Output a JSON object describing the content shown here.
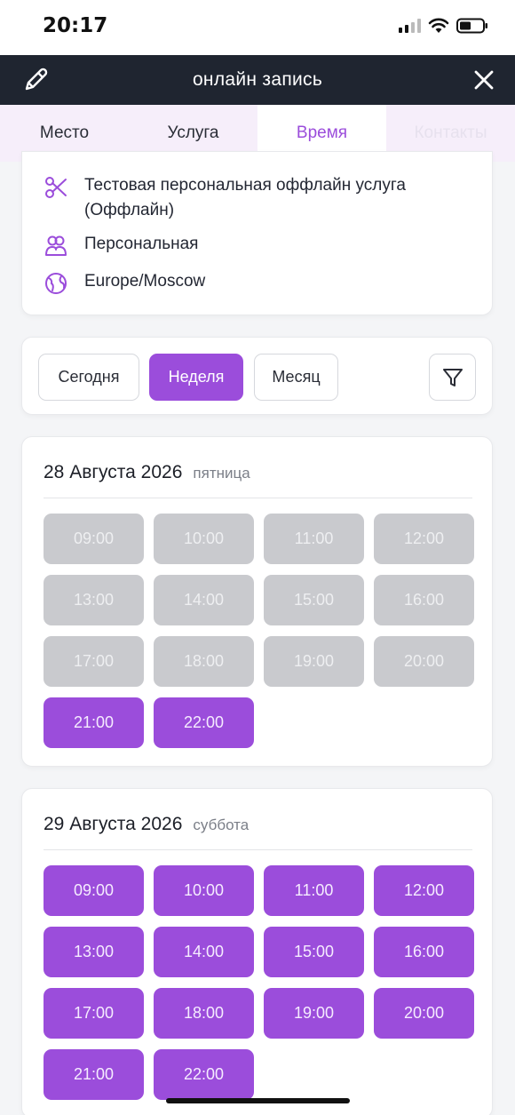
{
  "status": {
    "time": "20:17"
  },
  "header": {
    "title": "онлайн запись",
    "left_icon": "pencil-icon",
    "right_icon": "close-icon"
  },
  "tabs": [
    {
      "label": "Место",
      "state": "normal"
    },
    {
      "label": "Услуга",
      "state": "normal"
    },
    {
      "label": "Время",
      "state": "active"
    },
    {
      "label": "Контакты",
      "state": "disabled"
    }
  ],
  "info": {
    "service": "Тестовая персональная оффлайн услуга (Оффлайн)",
    "type": "Персональная",
    "timezone": "Europe/Moscow"
  },
  "filters": {
    "today": "Сегодня",
    "week": "Неделя",
    "month": "Месяц",
    "active": "week"
  },
  "days": [
    {
      "date": "28 Августа 2026",
      "weekday": "пятница",
      "slots": [
        {
          "time": "09:00",
          "available": false
        },
        {
          "time": "10:00",
          "available": false
        },
        {
          "time": "11:00",
          "available": false
        },
        {
          "time": "12:00",
          "available": false
        },
        {
          "time": "13:00",
          "available": false
        },
        {
          "time": "14:00",
          "available": false
        },
        {
          "time": "15:00",
          "available": false
        },
        {
          "time": "16:00",
          "available": false
        },
        {
          "time": "17:00",
          "available": false
        },
        {
          "time": "18:00",
          "available": false
        },
        {
          "time": "19:00",
          "available": false
        },
        {
          "time": "20:00",
          "available": false
        },
        {
          "time": "21:00",
          "available": true
        },
        {
          "time": "22:00",
          "available": true
        }
      ]
    },
    {
      "date": "29 Августа 2026",
      "weekday": "суббота",
      "slots": [
        {
          "time": "09:00",
          "available": true
        },
        {
          "time": "10:00",
          "available": true
        },
        {
          "time": "11:00",
          "available": true
        },
        {
          "time": "12:00",
          "available": true
        },
        {
          "time": "13:00",
          "available": true
        },
        {
          "time": "14:00",
          "available": true
        },
        {
          "time": "15:00",
          "available": true
        },
        {
          "time": "16:00",
          "available": true
        },
        {
          "time": "17:00",
          "available": true
        },
        {
          "time": "18:00",
          "available": true
        },
        {
          "time": "19:00",
          "available": true
        },
        {
          "time": "20:00",
          "available": true
        },
        {
          "time": "21:00",
          "available": true
        },
        {
          "time": "22:00",
          "available": true
        }
      ]
    }
  ],
  "colors": {
    "accent": "#9b4ddb",
    "header_bg": "#1f2530",
    "slot_busy": "#c9cace"
  }
}
